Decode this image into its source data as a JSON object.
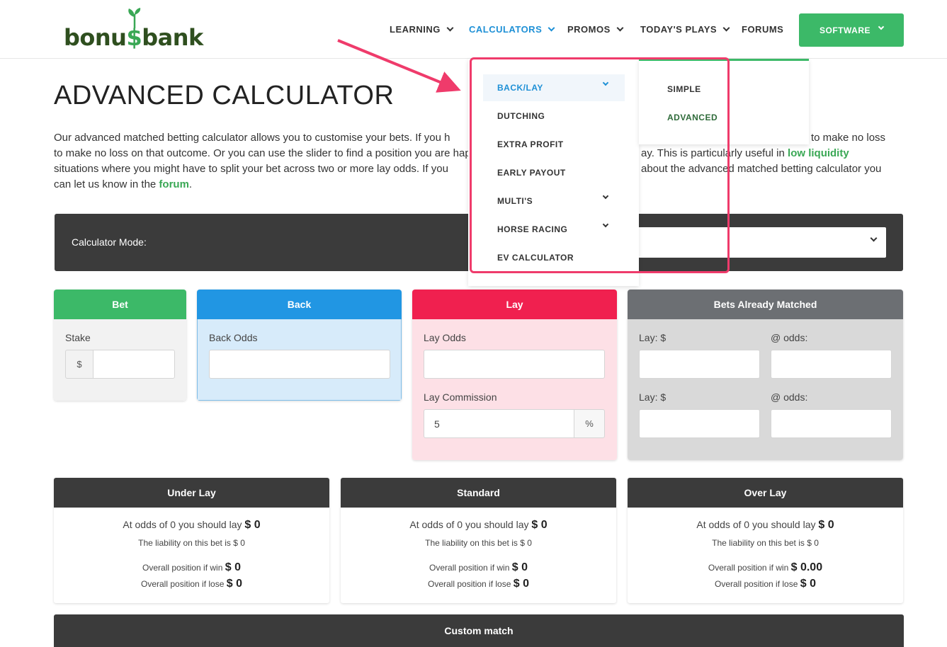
{
  "header": {
    "logo": "bonusbank",
    "nav": [
      {
        "label": "LEARNING",
        "active": false
      },
      {
        "label": "CALCULATORS",
        "active": true
      },
      {
        "label": "PROMOS",
        "active": false
      },
      {
        "label": "TODAY'S PLAYS",
        "active": false
      },
      {
        "label": "FORUMS",
        "active": false
      }
    ],
    "software_label": "SOFTWARE"
  },
  "page": {
    "title": "ADVANCED CALCULATOR",
    "intro_1": "Our advanced matched betting calculator allows you to customise your bets. If you h",
    "intro_2": "to make no loss on that outcome. Or you can use the slider to find a position you are happy with. You",
    "intro_3": "ay. This is particularly useful in ",
    "intro_link1": "low liquidity",
    "intro_4": " situations where you might have to split your bet across two or more lay odds. If you",
    "intro_5": "about the advanced matched betting calculator you can let us know in the ",
    "intro_link2": "forum",
    "intro_6": "."
  },
  "mode": {
    "label": "Calculator Mode:"
  },
  "bet": {
    "title": "Bet",
    "stake_label": "Stake",
    "currency": "$"
  },
  "back": {
    "title": "Back",
    "odds_label": "Back Odds"
  },
  "lay": {
    "title": "Lay",
    "odds_label": "Lay Odds",
    "commission_label": "Lay Commission",
    "commission_value": "5",
    "percent": "%"
  },
  "matched": {
    "title": "Bets Already Matched",
    "lay_label": "Lay: $",
    "odds_label": "@ odds:"
  },
  "results": [
    {
      "title": "Under Lay",
      "line1": "At odds of 0 you should lay ",
      "amount": "$ 0",
      "liability": "The liability on this bet is $ 0",
      "win_label": "Overall position if win ",
      "win": "$ 0",
      "lose_label": "Overall position if lose ",
      "lose": "$ 0"
    },
    {
      "title": "Standard",
      "line1": "At odds of 0 you should lay ",
      "amount": "$ 0",
      "liability": "The liability on this bet is $ 0",
      "win_label": "Overall position if win ",
      "win": "$ 0",
      "lose_label": "Overall position if lose ",
      "lose": "$ 0"
    },
    {
      "title": "Over Lay",
      "line1": "At odds of 0 you should lay ",
      "amount": "$ 0",
      "liability": "The liability on this bet is $ 0",
      "win_label": "Overall position if win ",
      "win": "$ 0.00",
      "lose_label": "Overall position if lose ",
      "lose": "$ 0"
    }
  ],
  "custom": {
    "title": "Custom match"
  },
  "dropdown": {
    "items": [
      "BACK/LAY",
      "DUTCHING",
      "EXTRA PROFIT",
      "EARLY PAYOUT",
      "MULTI'S",
      "HORSE RACING",
      "EV CALCULATOR"
    ],
    "sub_items": [
      "SIMPLE",
      "ADVANCED"
    ]
  },
  "colors": {
    "green": "#3cb968",
    "blue": "#2196e3",
    "red": "#f0204f",
    "gray": "#6c6f73",
    "dark": "#3b3b3b",
    "highlight": "#ef3b6b"
  }
}
